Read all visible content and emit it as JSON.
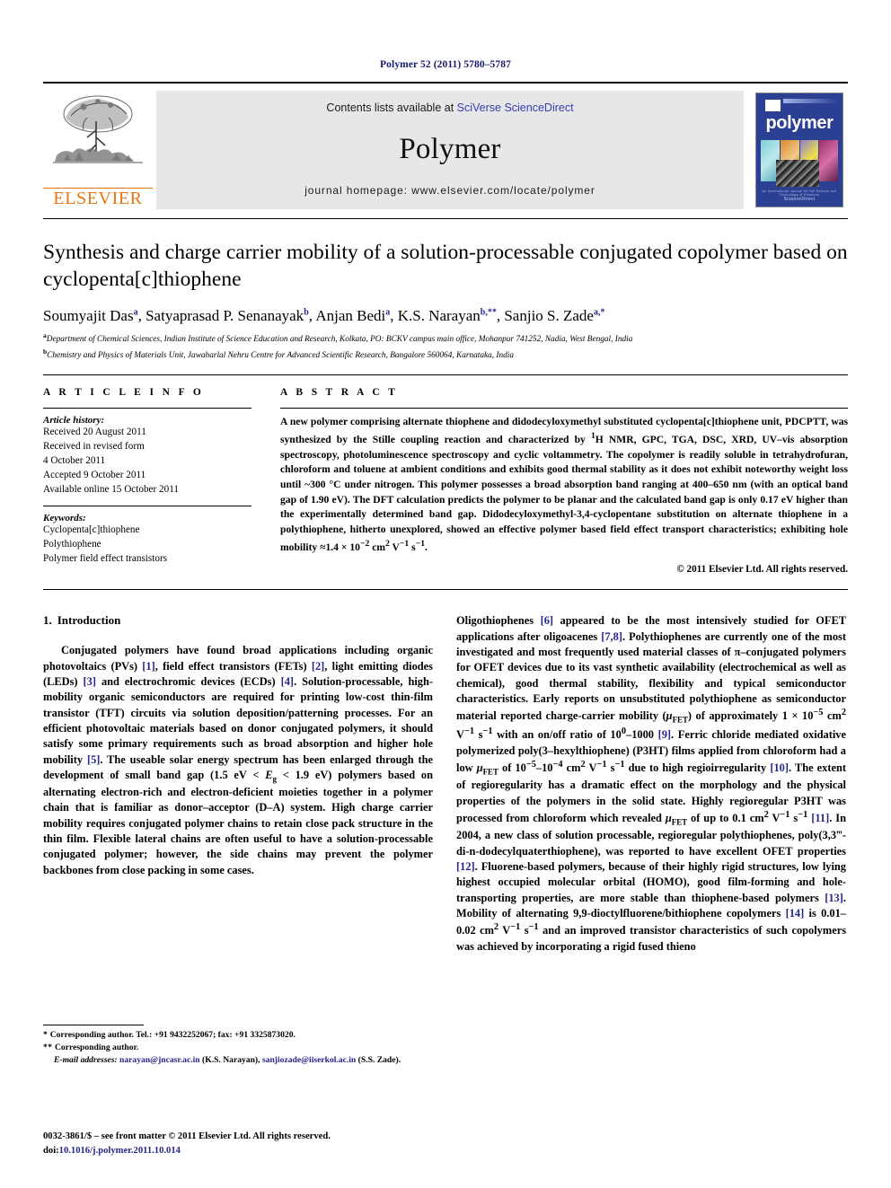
{
  "running_head": "Polymer 52 (2011) 5780–5787",
  "masthead": {
    "contents_prefix": "Contents lists available at ",
    "sciencedirect": "SciVerse ScienceDirect",
    "journal_title": "Polymer",
    "homepage": "journal homepage: www.elsevier.com/locate/polymer",
    "elsevier_wordmark": "ELSEVIER",
    "cover_title": "polymer",
    "cover_footer_small": "An International Journal for the Science and Technology of Polymers",
    "cover_footer": "ScienceDirect",
    "accent_orange": "#E87511",
    "cover_blue": "#2b3f93",
    "link_blue": "#3a3ab0"
  },
  "article": {
    "title": "Synthesis and charge carrier mobility of a solution-processable conjugated copolymer based on cyclopenta[c]thiophene",
    "authors": [
      {
        "name": "Soumyajit Das",
        "marks": "a"
      },
      {
        "name": "Satyaprasad P. Senanayak",
        "marks": "b"
      },
      {
        "name": "Anjan Bedi",
        "marks": "a"
      },
      {
        "name": "K.S. Narayan",
        "marks": "b,**"
      },
      {
        "name": "Sanjio S. Zade",
        "marks": "a,*"
      }
    ],
    "affiliations": [
      {
        "mark": "a",
        "text": "Department of Chemical Sciences, Indian Institute of Science Education and Research, Kolkata, PO: BCKV campus main office, Mohanpur 741252, Nadia, West Bengal, India"
      },
      {
        "mark": "b",
        "text": "Chemistry and Physics of Materials Unit, Jawaharlal Nehru Centre for Advanced Scientific Research, Bangalore 560064, Karnataka, India"
      }
    ]
  },
  "article_info": {
    "label": "A R T I C L E  I N F O",
    "history_heading": "Article history:",
    "history": [
      "Received 20 August 2011",
      "Received in revised form",
      "4 October 2011",
      "Accepted 9 October 2011",
      "Available online 15 October 2011"
    ],
    "keywords_heading": "Keywords:",
    "keywords": [
      "Cyclopenta[c]thiophene",
      "Polythiophene",
      "Polymer field effect transistors"
    ]
  },
  "abstract": {
    "label": "A B S T R A C T",
    "text_part1": "A new polymer comprising alternate thiophene and didodecyloxymethyl substituted cyclopenta[c]thiophene unit, ",
    "polymer_name": "PDCPTT",
    "text_part2": ", was synthesized by the Stille coupling reaction and characterized by 1H NMR, GPC, TGA, DSC, XRD, UV–vis absorption spectroscopy, photoluminescence spectroscopy and cyclic voltammetry. The copolymer is readily soluble in tetrahydrofuran, chloroform and toluene at ambient conditions and exhibits good thermal stability as it does not exhibit noteworthy weight loss until ~300 °C under nitrogen. This polymer possesses a broad absorption band ranging at 400–650 nm (with an optical band gap of 1.90 eV). The DFT calculation predicts the polymer to be planar and the calculated band gap is only 0.17 eV higher than the experimentally determined band gap. Didodecyloxymethyl-3,4-cyclopentane substitution on alternate thiophene in a polythiophene, hitherto unexplored, showed an effective polymer based field effect transport characteristics; exhibiting hole mobility ≈1.4 × 10−2 cm2 V−1 s−1.",
    "copyright": "© 2011 Elsevier Ltd. All rights reserved."
  },
  "introduction": {
    "number": "1.",
    "heading": "Introduction",
    "left_paragraph": "Conjugated polymers have found broad applications including organic photovoltaics (PVs) [1], field effect transistors (FETs) [2], light emitting diodes (LEDs) [3] and electrochromic devices (ECDs) [4]. Solution-processable, high-mobility organic semiconductors are required for printing low-cost thin-film transistor (TFT) circuits via solution deposition/patterning processes. For an efficient photovoltaic materials based on donor conjugated polymers, it should satisfy some primary requirements such as broad absorption and higher hole mobility [5]. The useable solar energy spectrum has been enlarged through the development of small band gap (1.5 eV < Eg < 1.9 eV) polymers based on alternating electron-rich and electron-deficient moieties together in a polymer chain that is familiar as donor–acceptor (D–A) system. High charge carrier mobility requires conjugated polymer chains to retain close pack structure in the thin film. Flexible lateral chains are often useful to have a solution-processable conjugated polymer; however, the side chains may prevent the polymer backbones from close packing in some cases.",
    "right_paragraph": "Oligothiophenes [6] appeared to be the most intensively studied for OFET applications after oligoacenes [7,8]. Polythiophenes are currently one of the most investigated and most frequently used material classes of π–conjugated polymers for OFET devices due to its vast synthetic availability (electrochemical as well as chemical), good thermal stability, flexibility and typical semiconductor characteristics. Early reports on unsubstituted polythiophene as semiconductor material reported charge-carrier mobility (μFET) of approximately 1 × 10−5 cm2 V−1 s−1 with an on/off ratio of 100–1000 [9]. Ferric chloride mediated oxidative polymerized poly(3–hexylthiophene) (P3HT) films applied from chloroform had a low μFET of 10−5–10−4 cm2 V−1 s−1 due to high regioirregularity [10]. The extent of regioregularity has a dramatic effect on the morphology and the physical properties of the polymers in the solid state. Highly regioregular P3HT was processed from chloroform which revealed μFET of up to 0.1 cm2 V−1 s−1 [11]. In 2004, a new class of solution processable, regioregular polythiophenes, poly(3,3‴-di-n-dodecylquaterthiophene), was reported to have excellent OFET properties [12]. Fluorene-based polymers, because of their highly rigid structures, low lying highest occupied molecular orbital (HOMO), good film-forming and hole-transporting properties, are more stable than thiophene-based polymers [13]. Mobility of alternating 9,9-dioctylfluorene/bithiophene copolymers [14] is 0.01–0.02 cm2 V−1 s−1 and an improved transistor characteristics of such copolymers was achieved by incorporating a rigid fused thieno"
  },
  "footnotes": {
    "line1_mark": "*",
    "line1": "Corresponding author. Tel.: +91 9432252067; fax: +91 3325873020.",
    "line2_mark": "**",
    "line2": "Corresponding author.",
    "email_label": "E-mail addresses:",
    "email1": "narayan@jncasr.ac.in",
    "email1_owner": "(K.S. Narayan),",
    "email2": "sanjiozade@iiserkol.ac.in",
    "email2_owner": "(S.S. Zade)."
  },
  "page_footer": {
    "line1": "0032-3861/$ – see front matter © 2011 Elsevier Ltd. All rights reserved.",
    "doi_prefix": "doi:",
    "doi": "10.1016/j.polymer.2011.10.014"
  }
}
